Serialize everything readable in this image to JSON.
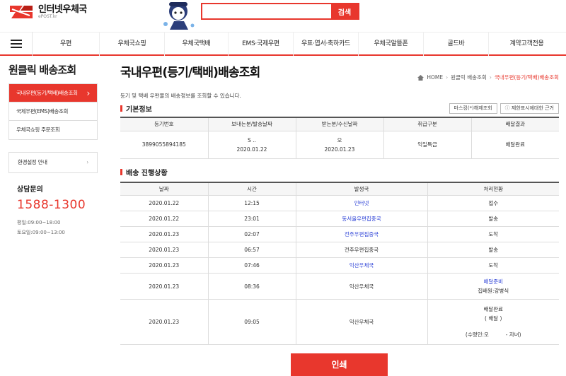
{
  "header": {
    "logo_title": "인터넷우체국",
    "logo_sub": "ePOST.kr",
    "search_placeholder": "",
    "search_button": "검색"
  },
  "gnb": {
    "items": [
      "우편",
      "우체국쇼핑",
      "우체국택배",
      "EMS·국제우편",
      "우표·엽서·축하카드",
      "우체국알뜰폰",
      "골드바",
      "계약고객전용"
    ]
  },
  "lnb": {
    "title": "원클릭 배송조회",
    "items": [
      "국내우편(등기/택배)배송조회",
      "국제우편(EMS)배송조회",
      "우체국쇼핑 주문조회"
    ],
    "env_label": "환경설정 안내",
    "cs_title": "상담문의",
    "cs_number": "1588-1300",
    "cs_weekday": "평일:09:00~18:00",
    "cs_saturday": "토요일:09:00~13:00"
  },
  "main": {
    "title": "국내우편(등기/택배)배송조회",
    "breadcrumb": [
      "HOME",
      "원클릭 배송조회",
      "국내우편(등기/택배)배송조회"
    ],
    "description": "등기 및 택배 우편물의 배송정보를 조회할 수 있습니다.",
    "basic_title": "기본정보",
    "btn_masking": "마스킹(*)해제조회",
    "btn_basis": "제한표시에대한 근거",
    "basic_headers": [
      "등기번호",
      "보내는분/발송날짜",
      "받는분/수신날짜",
      "취급구분",
      "배달결과"
    ],
    "basic_row": {
      "reg_no": "3899055894185",
      "sender": "S ..",
      "send_date": "2020.01.22",
      "receiver": "오",
      "recv_date": "2020.01.23",
      "type": "익일특급",
      "result": "배달완료"
    },
    "track_title": "배송 진행상황",
    "track_headers": [
      "날짜",
      "시간",
      "발생국",
      "처리현황"
    ],
    "track_rows": [
      {
        "date": "2020.01.22",
        "time": "12:15",
        "office": "인터넷",
        "status": "접수"
      },
      {
        "date": "2020.01.22",
        "time": "23:01",
        "office": "동서울우편집중국",
        "status": "발송"
      },
      {
        "date": "2020.01.23",
        "time": "02:07",
        "office": "전주우편집중국",
        "status": "도착"
      },
      {
        "date": "2020.01.23",
        "time": "06:57",
        "office": "전주우편집중국",
        "status": "발송"
      },
      {
        "date": "2020.01.23",
        "time": "07:46",
        "office": "익산우체국",
        "status": "도착"
      },
      {
        "date": "2020.01.23",
        "time": "08:36",
        "office": "익산우체국",
        "status": "배달준비",
        "status_sub": "집배원:강병식"
      },
      {
        "date": "2020.01.23",
        "time": "09:05",
        "office": "익산우체국",
        "status": "배달완료",
        "status_sub": "( 배달 )",
        "status_sub2": "(수령인:오          - 자녀)"
      }
    ],
    "print_button": "인쇄"
  },
  "colors": {
    "accent": "#e8372d",
    "link": "#2a3fd6"
  }
}
